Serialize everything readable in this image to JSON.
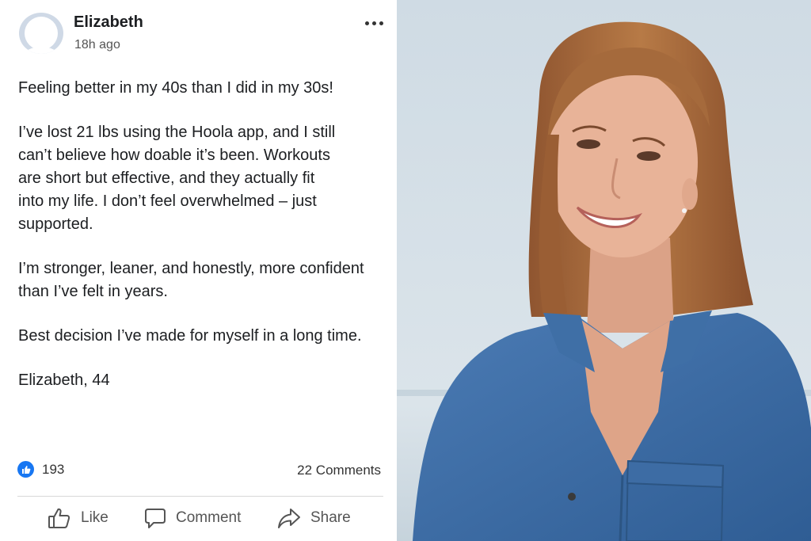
{
  "post": {
    "author": "Elizabeth",
    "time": "18h ago",
    "paragraphs": [
      "Feeling better in my 40s than I did in my 30s!",
      "I’ve lost 21 lbs using the Hoola app, and I still\ncan’t believe how doable it’s been. Workouts\nare short but effective, and they actually fit\ninto my life. I don’t feel overwhelmed – just\nsupported.",
      "I’m stronger, leaner, and honestly, more confident\nthan I’ve felt in years.",
      "Best decision I’ve made for myself in a long time.",
      "Elizabeth, 44"
    ],
    "reactions_count": "193",
    "comments_label": "22 Comments"
  },
  "actions": {
    "like": "Like",
    "comment": "Comment",
    "share": "Share"
  },
  "colors": {
    "like_blue": "#1877f2",
    "text": "#1c1e21",
    "muted": "#555555",
    "shirt": "#3f6fa8",
    "hair": "#a8683a",
    "skin": "#e7b196",
    "sky": "#d4dfe6"
  },
  "icons": [
    "default-avatar-icon",
    "more-options-icon",
    "thumbs-up-icon",
    "comment-icon",
    "share-icon"
  ]
}
